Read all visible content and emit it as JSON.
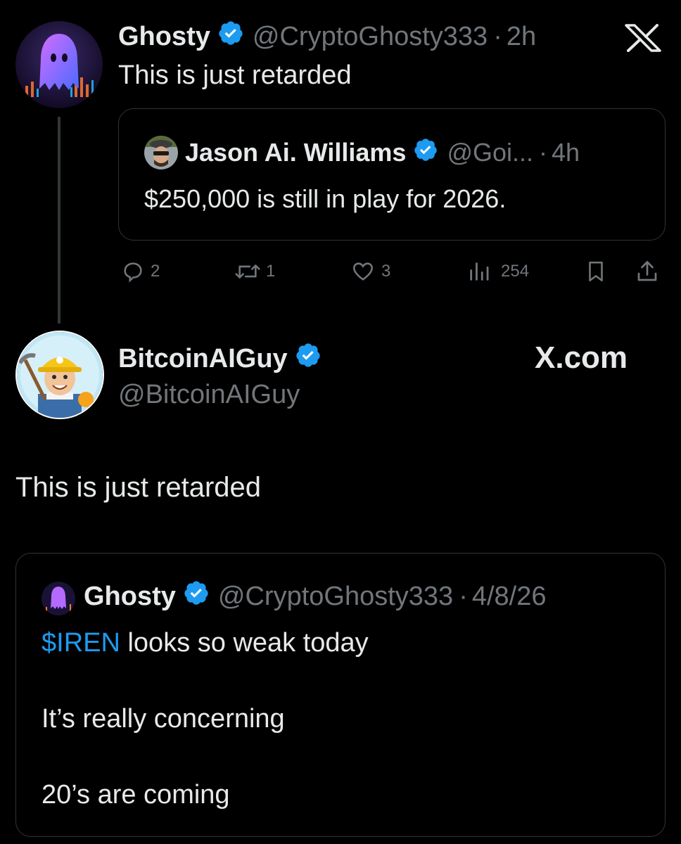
{
  "post1": {
    "author_name": "Ghosty",
    "handle": "@CryptoGhosty333",
    "separator": "·",
    "time": "2h",
    "text": "This is just retarded",
    "quoted": {
      "author_name": "Jason Ai. Williams",
      "handle": "@Goi...",
      "separator": "·",
      "time": "4h",
      "text": "$250,000 is still in play for 2026."
    },
    "actions": {
      "replies": "2",
      "reposts": "1",
      "likes": "3",
      "views": "254"
    }
  },
  "brand": {
    "top_logo_icon": "x-logo-icon",
    "domain_text": "X.com"
  },
  "profile": {
    "name": "BitcoinAIGuy",
    "handle": "@BitcoinAIGuy"
  },
  "post2": {
    "text": "This is just retarded",
    "quoted": {
      "author_name": "Ghosty",
      "handle": "@CryptoGhosty333",
      "separator": "·",
      "time": "4/8/26",
      "cashtag": "$IREN",
      "line1_rest": " looks so weak today",
      "line2": "It’s really concerning",
      "line3": "20’s are coming"
    }
  },
  "colors": {
    "background": "#000000",
    "text": "#e7e9ea",
    "muted": "#71767b",
    "link": "#1d9bf0",
    "verified": "#1d9bf0",
    "border": "#2f3336"
  }
}
